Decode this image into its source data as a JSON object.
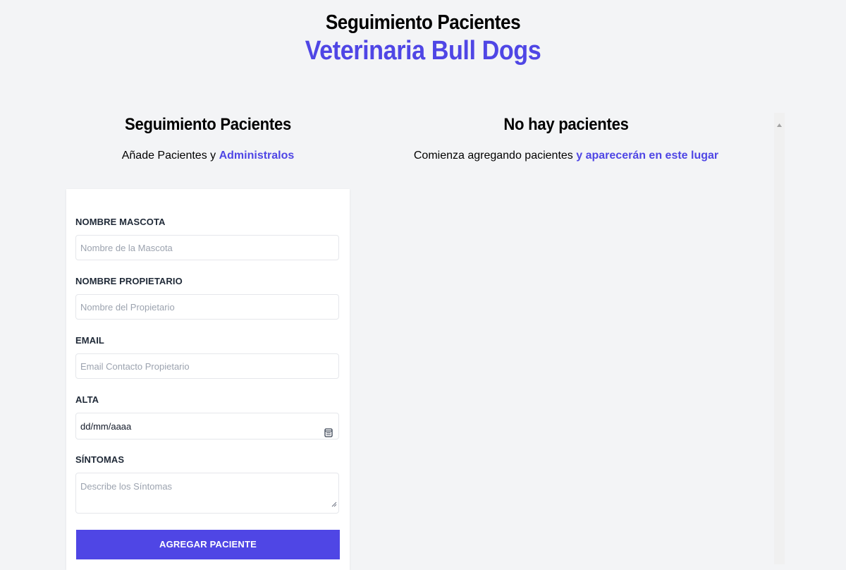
{
  "header": {
    "title": "Seguimiento Pacientes",
    "subtitle": "Veterinaria Bull Dogs"
  },
  "form_section": {
    "title": "Seguimiento Pacientes",
    "sub_text": "Añade Pacientes y",
    "sub_accent": "Administralos"
  },
  "list_section": {
    "title": "No hay pacientes",
    "sub_text": "Comienza agregando pacientes",
    "sub_accent": "y aparecerán en este lugar"
  },
  "form": {
    "fields": [
      {
        "label": "NOMBRE MASCOTA",
        "placeholder": "Nombre de la Mascota"
      },
      {
        "label": "NOMBRE PROPIETARIO",
        "placeholder": "Nombre del Propietario"
      },
      {
        "label": "EMAIL",
        "placeholder": "Email Contacto Propietario"
      },
      {
        "label": "ALTA",
        "value": "dd/mm/aaaa"
      },
      {
        "label": "SÍNTOMAS",
        "placeholder": "Describe los Síntomas"
      }
    ],
    "submit_label": "AGREGAR PACIENTE"
  },
  "icons": {
    "calendar": "calendar-icon",
    "resize": "resize-handle-icon",
    "scroll_up": "scroll-up-arrow-icon"
  },
  "colors": {
    "accent": "#4f46e5",
    "background": "#f3f4f6",
    "card": "#ffffff",
    "input_border": "#e5e7eb"
  }
}
